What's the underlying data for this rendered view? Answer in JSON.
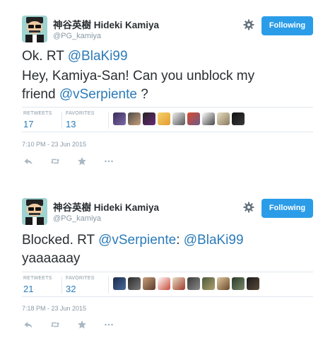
{
  "tweets": [
    {
      "author_name": "神谷英樹 Hideki Kamiya",
      "handle": "@PG_kamiya",
      "follow_label": "Following",
      "text_line1": [
        "Ok. RT ",
        "@BlaKi99"
      ],
      "text_line2": "Hey, Kamiya-San! Can you unblock my",
      "text_line3": [
        "friend ",
        "@vSerpiente",
        " ?"
      ],
      "retweets_label": "RETWEETS",
      "retweets_count": "17",
      "favorites_label": "FAVORITES",
      "favorites_count": "13",
      "timestamp": "7:10 PM - 23 Jun 2015"
    },
    {
      "author_name": "神谷英樹 Hideki Kamiya",
      "handle": "@PG_kamiya",
      "follow_label": "Following",
      "text_line1": [
        "Blocked. RT ",
        "@vSerpiente",
        ": ",
        "@BlaKi99"
      ],
      "text_line2": "yaaaaaay",
      "retweets_label": "RETWEETS",
      "retweets_count": "21",
      "favorites_label": "FAVORITES",
      "favorites_count": "32",
      "timestamp": "7:18 PM - 23 Jun 2015"
    }
  ],
  "colors": {
    "accent": "#2b9de8",
    "link": "#2b7bb9",
    "muted": "#8899a6"
  },
  "icons": [
    "gear-icon",
    "reply-icon",
    "retweet-icon",
    "favorite-icon",
    "more-icon"
  ]
}
